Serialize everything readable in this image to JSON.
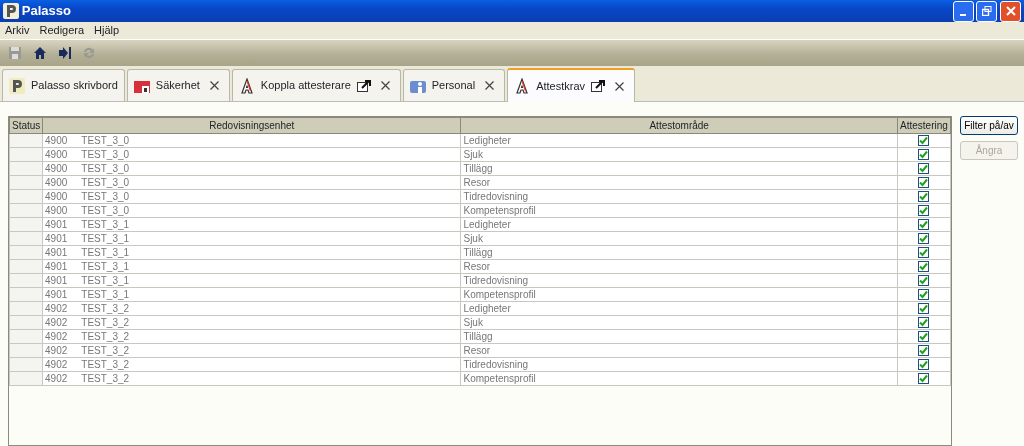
{
  "window": {
    "title": "Palasso"
  },
  "menu": [
    "Arkiv",
    "Redigera",
    "Hjälp"
  ],
  "toolbar": [
    {
      "kind": "save",
      "disabled": true
    },
    {
      "kind": "home",
      "disabled": false
    },
    {
      "kind": "exit",
      "disabled": false
    },
    {
      "kind": "refresh",
      "disabled": true
    }
  ],
  "tabs": [
    {
      "label": "Palasso skrivbord",
      "kind": "app",
      "closable": false,
      "detachable": false,
      "selected": false
    },
    {
      "label": "Säkerhet",
      "kind": "security",
      "closable": true,
      "detachable": false,
      "selected": false
    },
    {
      "label": "Koppla attesterare",
      "kind": "attest",
      "closable": true,
      "detachable": true,
      "selected": false
    },
    {
      "label": "Personal",
      "kind": "staff",
      "closable": true,
      "detachable": false,
      "selected": false
    },
    {
      "label": "Attestkrav",
      "kind": "attest",
      "closable": true,
      "detachable": true,
      "selected": true
    }
  ],
  "table": {
    "columns": [
      "Status",
      "Redovisningsenhet",
      "Attestområde",
      "Attestering"
    ],
    "rows": [
      {
        "code": "4900",
        "unit": "TEST_3_0",
        "area": "Ledigheter",
        "checked": true
      },
      {
        "code": "4900",
        "unit": "TEST_3_0",
        "area": "Sjuk",
        "checked": true
      },
      {
        "code": "4900",
        "unit": "TEST_3_0",
        "area": "Tillägg",
        "checked": true
      },
      {
        "code": "4900",
        "unit": "TEST_3_0",
        "area": "Resor",
        "checked": true
      },
      {
        "code": "4900",
        "unit": "TEST_3_0",
        "area": "Tidredovisning",
        "checked": true
      },
      {
        "code": "4900",
        "unit": "TEST_3_0",
        "area": "Kompetensprofil",
        "checked": true
      },
      {
        "code": "4901",
        "unit": "TEST_3_1",
        "area": "Ledigheter",
        "checked": true
      },
      {
        "code": "4901",
        "unit": "TEST_3_1",
        "area": "Sjuk",
        "checked": true
      },
      {
        "code": "4901",
        "unit": "TEST_3_1",
        "area": "Tillägg",
        "checked": true
      },
      {
        "code": "4901",
        "unit": "TEST_3_1",
        "area": "Resor",
        "checked": true
      },
      {
        "code": "4901",
        "unit": "TEST_3_1",
        "area": "Tidredovisning",
        "checked": true
      },
      {
        "code": "4901",
        "unit": "TEST_3_1",
        "area": "Kompetensprofil",
        "checked": true
      },
      {
        "code": "4902",
        "unit": "TEST_3_2",
        "area": "Ledigheter",
        "checked": true
      },
      {
        "code": "4902",
        "unit": "TEST_3_2",
        "area": "Sjuk",
        "checked": true
      },
      {
        "code": "4902",
        "unit": "TEST_3_2",
        "area": "Tillägg",
        "checked": true
      },
      {
        "code": "4902",
        "unit": "TEST_3_2",
        "area": "Resor",
        "checked": true
      },
      {
        "code": "4902",
        "unit": "TEST_3_2",
        "area": "Tidredovisning",
        "checked": true
      },
      {
        "code": "4902",
        "unit": "TEST_3_2",
        "area": "Kompetensprofil",
        "checked": true
      }
    ]
  },
  "buttons": [
    {
      "label": "Filter på/av",
      "disabled": false
    },
    {
      "label": "Ångra",
      "disabled": true
    }
  ]
}
